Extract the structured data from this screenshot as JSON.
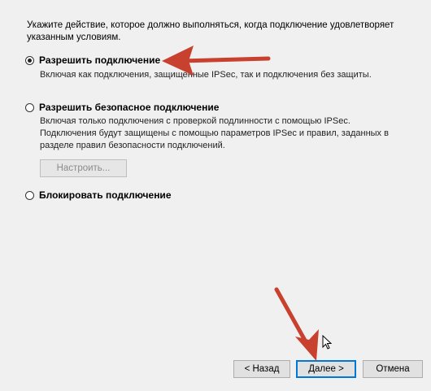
{
  "intro_text": "Укажите действие, которое должно выполняться, когда подключение удовлетворяет указанным условиям.",
  "options": [
    {
      "label": "Разрешить подключение",
      "checked": true,
      "description": "Включая как подключения, защищенные IPSec, так и подключения без защиты."
    },
    {
      "label": "Разрешить безопасное подключение",
      "checked": false,
      "description": "Включая только подключения с проверкой подлинности с помощью IPSec. Подключения будут защищены с помощью параметров IPSec и правил, заданных в разделе правил безопасности подключений."
    },
    {
      "label": "Блокировать подключение",
      "checked": false
    }
  ],
  "configure_button": "Настроить...",
  "nav": {
    "back": "< Назад",
    "next": "Далее >",
    "cancel": "Отмена"
  },
  "colors": {
    "annotation_arrow": "#c8412e",
    "default_button_border": "#0078d7"
  }
}
